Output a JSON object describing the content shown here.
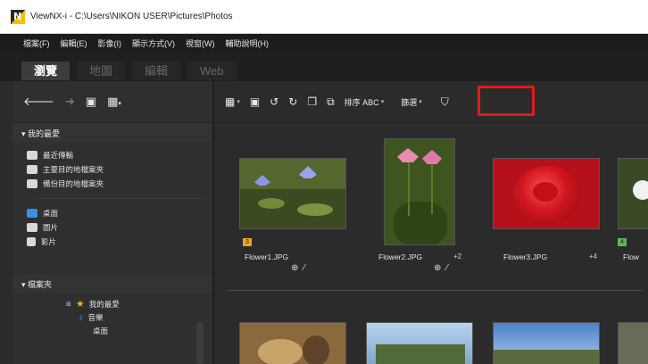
{
  "window": {
    "title": "ViewNX-i - C:\\Users\\NIKON USER\\Pictures\\Photos"
  },
  "menu": [
    "檔案(F)",
    "編輯(E)",
    "影像(I)",
    "顯示方式(V)",
    "視窗(W)",
    "輔助說明(H)"
  ],
  "modes": [
    "瀏覽",
    "地圖",
    "編輯",
    "Web"
  ],
  "sidebar": {
    "favorites_header": "▾ 我的最愛",
    "favorites": [
      "最近傳輸",
      "主要目的地檔案夾",
      "備份目的地檔案夾"
    ],
    "libraries": [
      "桌面",
      "圖片",
      "影片"
    ],
    "folders_header": "▾ 檔案夾",
    "tree": [
      "我的最愛",
      "音樂",
      "桌面"
    ]
  },
  "toolbar": {
    "sort_label": "排序 ABC",
    "filter_label": "篩選"
  },
  "thumbnails": [
    {
      "filename": "Flower1.JPG",
      "count": "",
      "rating": "3",
      "rating_color": "#f2a31b"
    },
    {
      "filename": "Flower2.JPG",
      "count": "+2",
      "rating": "",
      "rating_color": ""
    },
    {
      "filename": "Flower3.JPG",
      "count": "+4",
      "rating": "",
      "rating_color": ""
    },
    {
      "filename": "Flow",
      "count": "",
      "rating": "4",
      "rating_color": "#5cb85c"
    }
  ],
  "colors": {
    "highlight": "#e21b1b",
    "window_bg": "#2b2b2b"
  }
}
